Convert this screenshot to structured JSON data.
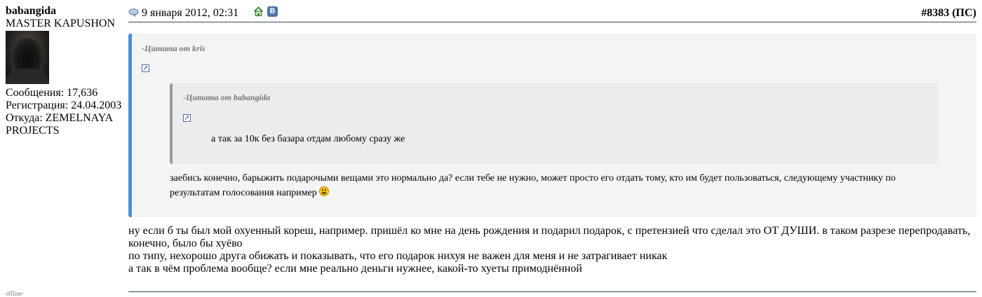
{
  "author": {
    "username": "babangida",
    "title": "MASTER KAPUSHON",
    "posts": "Сообщения: 17,636",
    "registered": "Регистрация: 24.04.2003",
    "from_line1": "Откуда: ZEMELNAYA",
    "from_line2": "PROJECTS",
    "status": "offline"
  },
  "post": {
    "date": "9 января 2012, 02:31",
    "number": "#8383",
    "tag": "(ПС)"
  },
  "icons": {
    "post_icon": "speech-bubble-icon",
    "home": "home-icon",
    "vk": "vk-icon",
    "vk_letter": "В"
  },
  "quote_outer": {
    "meta": "-Цитата от kris",
    "text": "заебись конечно, барыжить подарочыми вещами это нормально да? если тебе не нужно, может просто его отдать тому, кто им будет пользоваться, следующему участнику по результатам голосования например"
  },
  "quote_inner": {
    "meta": "-Цитата от babangida",
    "text": "а так за 10к без базара отдам любому сразу же"
  },
  "message": {
    "line1": "ну если б ты был мой охуенный кореш, например. пришёл ко мне на день рождения и подарил подарок, с претензией что сделал это ОТ ДУШИ. в таком разрезе перепродавать, конечно, было бы хуёво",
    "line2": "по типу, нехорошо друга обижать и показывать, что его подарок нихуя не важен для меня и не затрагивает никак",
    "line3": "а так в чём проблема вообще? если мне реально деньги нужнее, какой-то хуеты примоднённой"
  },
  "colors": {
    "quote_bar": "#4a90d9",
    "inner_bar": "#9a9a9a",
    "rule": "#3a4a5e"
  }
}
